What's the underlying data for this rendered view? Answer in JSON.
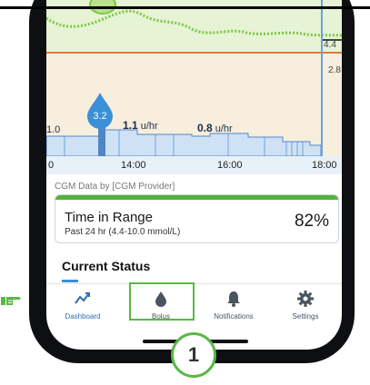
{
  "chart": {
    "ref_labels": {
      "high": "4.4",
      "low": "2.8"
    },
    "bolus": {
      "value": "3.2"
    },
    "basal_labels": [
      {
        "value": "1.0"
      },
      {
        "value": "1.1",
        "unit": "u/hr"
      },
      {
        "value": "0.8",
        "unit": "u/hr"
      }
    ],
    "x_ticks": [
      "0",
      "14:00",
      "16:00",
      "18:00"
    ]
  },
  "provider_label": "CGM Data by [CGM Provider]",
  "time_in_range": {
    "title": "Time in Range",
    "subtitle": "Past 24 hr (4.4-10.0 mmol/L)",
    "percent": "82%"
  },
  "current_status": {
    "title": "Current Status"
  },
  "tabs": [
    {
      "label": "Dashboard",
      "icon": "trend-icon"
    },
    {
      "label": "Bolus",
      "icon": "drop-icon"
    },
    {
      "label": "Notifications",
      "icon": "bell-icon"
    },
    {
      "label": "Settings",
      "icon": "gear-icon"
    }
  ],
  "callout": {
    "number": "1"
  },
  "colors": {
    "highlight": "#5ab847",
    "accent": "#3b8fd8"
  }
}
